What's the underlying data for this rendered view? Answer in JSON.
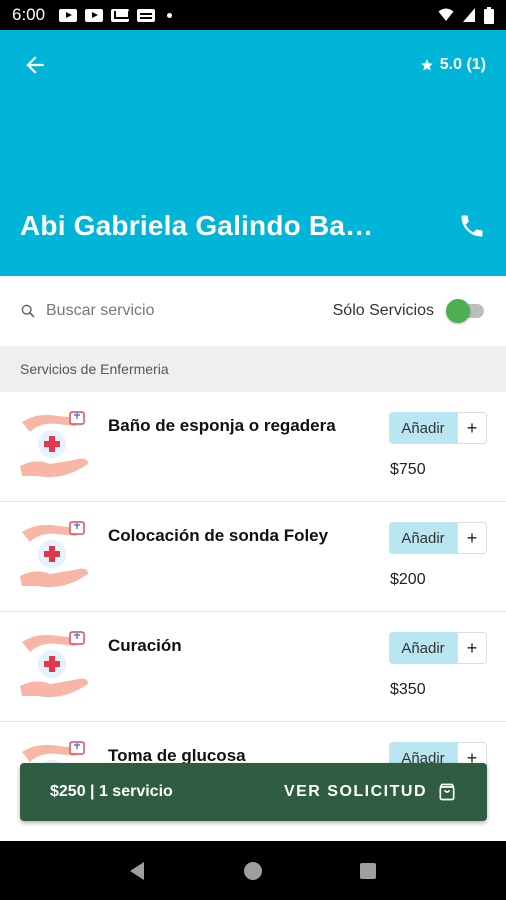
{
  "status_bar": {
    "time": "6:00"
  },
  "header": {
    "rating": "5.0 (1)",
    "title": "Abi Gabriela Galindo Ba…"
  },
  "search": {
    "placeholder": "Buscar servicio"
  },
  "filter": {
    "label": "Sólo Servicios"
  },
  "section": {
    "title": "Servicios de Enfermeria"
  },
  "services": [
    {
      "name": "Baño de esponja o regadera",
      "add_label": "Añadir",
      "plus": "+",
      "price": "$750"
    },
    {
      "name": "Colocación de sonda Foley",
      "add_label": "Añadir",
      "plus": "+",
      "price": "$200"
    },
    {
      "name": "Curación",
      "add_label": "Añadir",
      "plus": "+",
      "price": "$350"
    },
    {
      "name": "Toma de glucosa",
      "add_label": "Añadir",
      "plus": "+",
      "price": ""
    }
  ],
  "cart": {
    "summary": "$250 | 1 servicio",
    "action": "VER SOLICITUD"
  },
  "colors": {
    "header_bg": "#00b5d8",
    "cart_bg": "#2f5d41",
    "add_bg": "#b9e6f1",
    "toggle": "#4caf50"
  }
}
